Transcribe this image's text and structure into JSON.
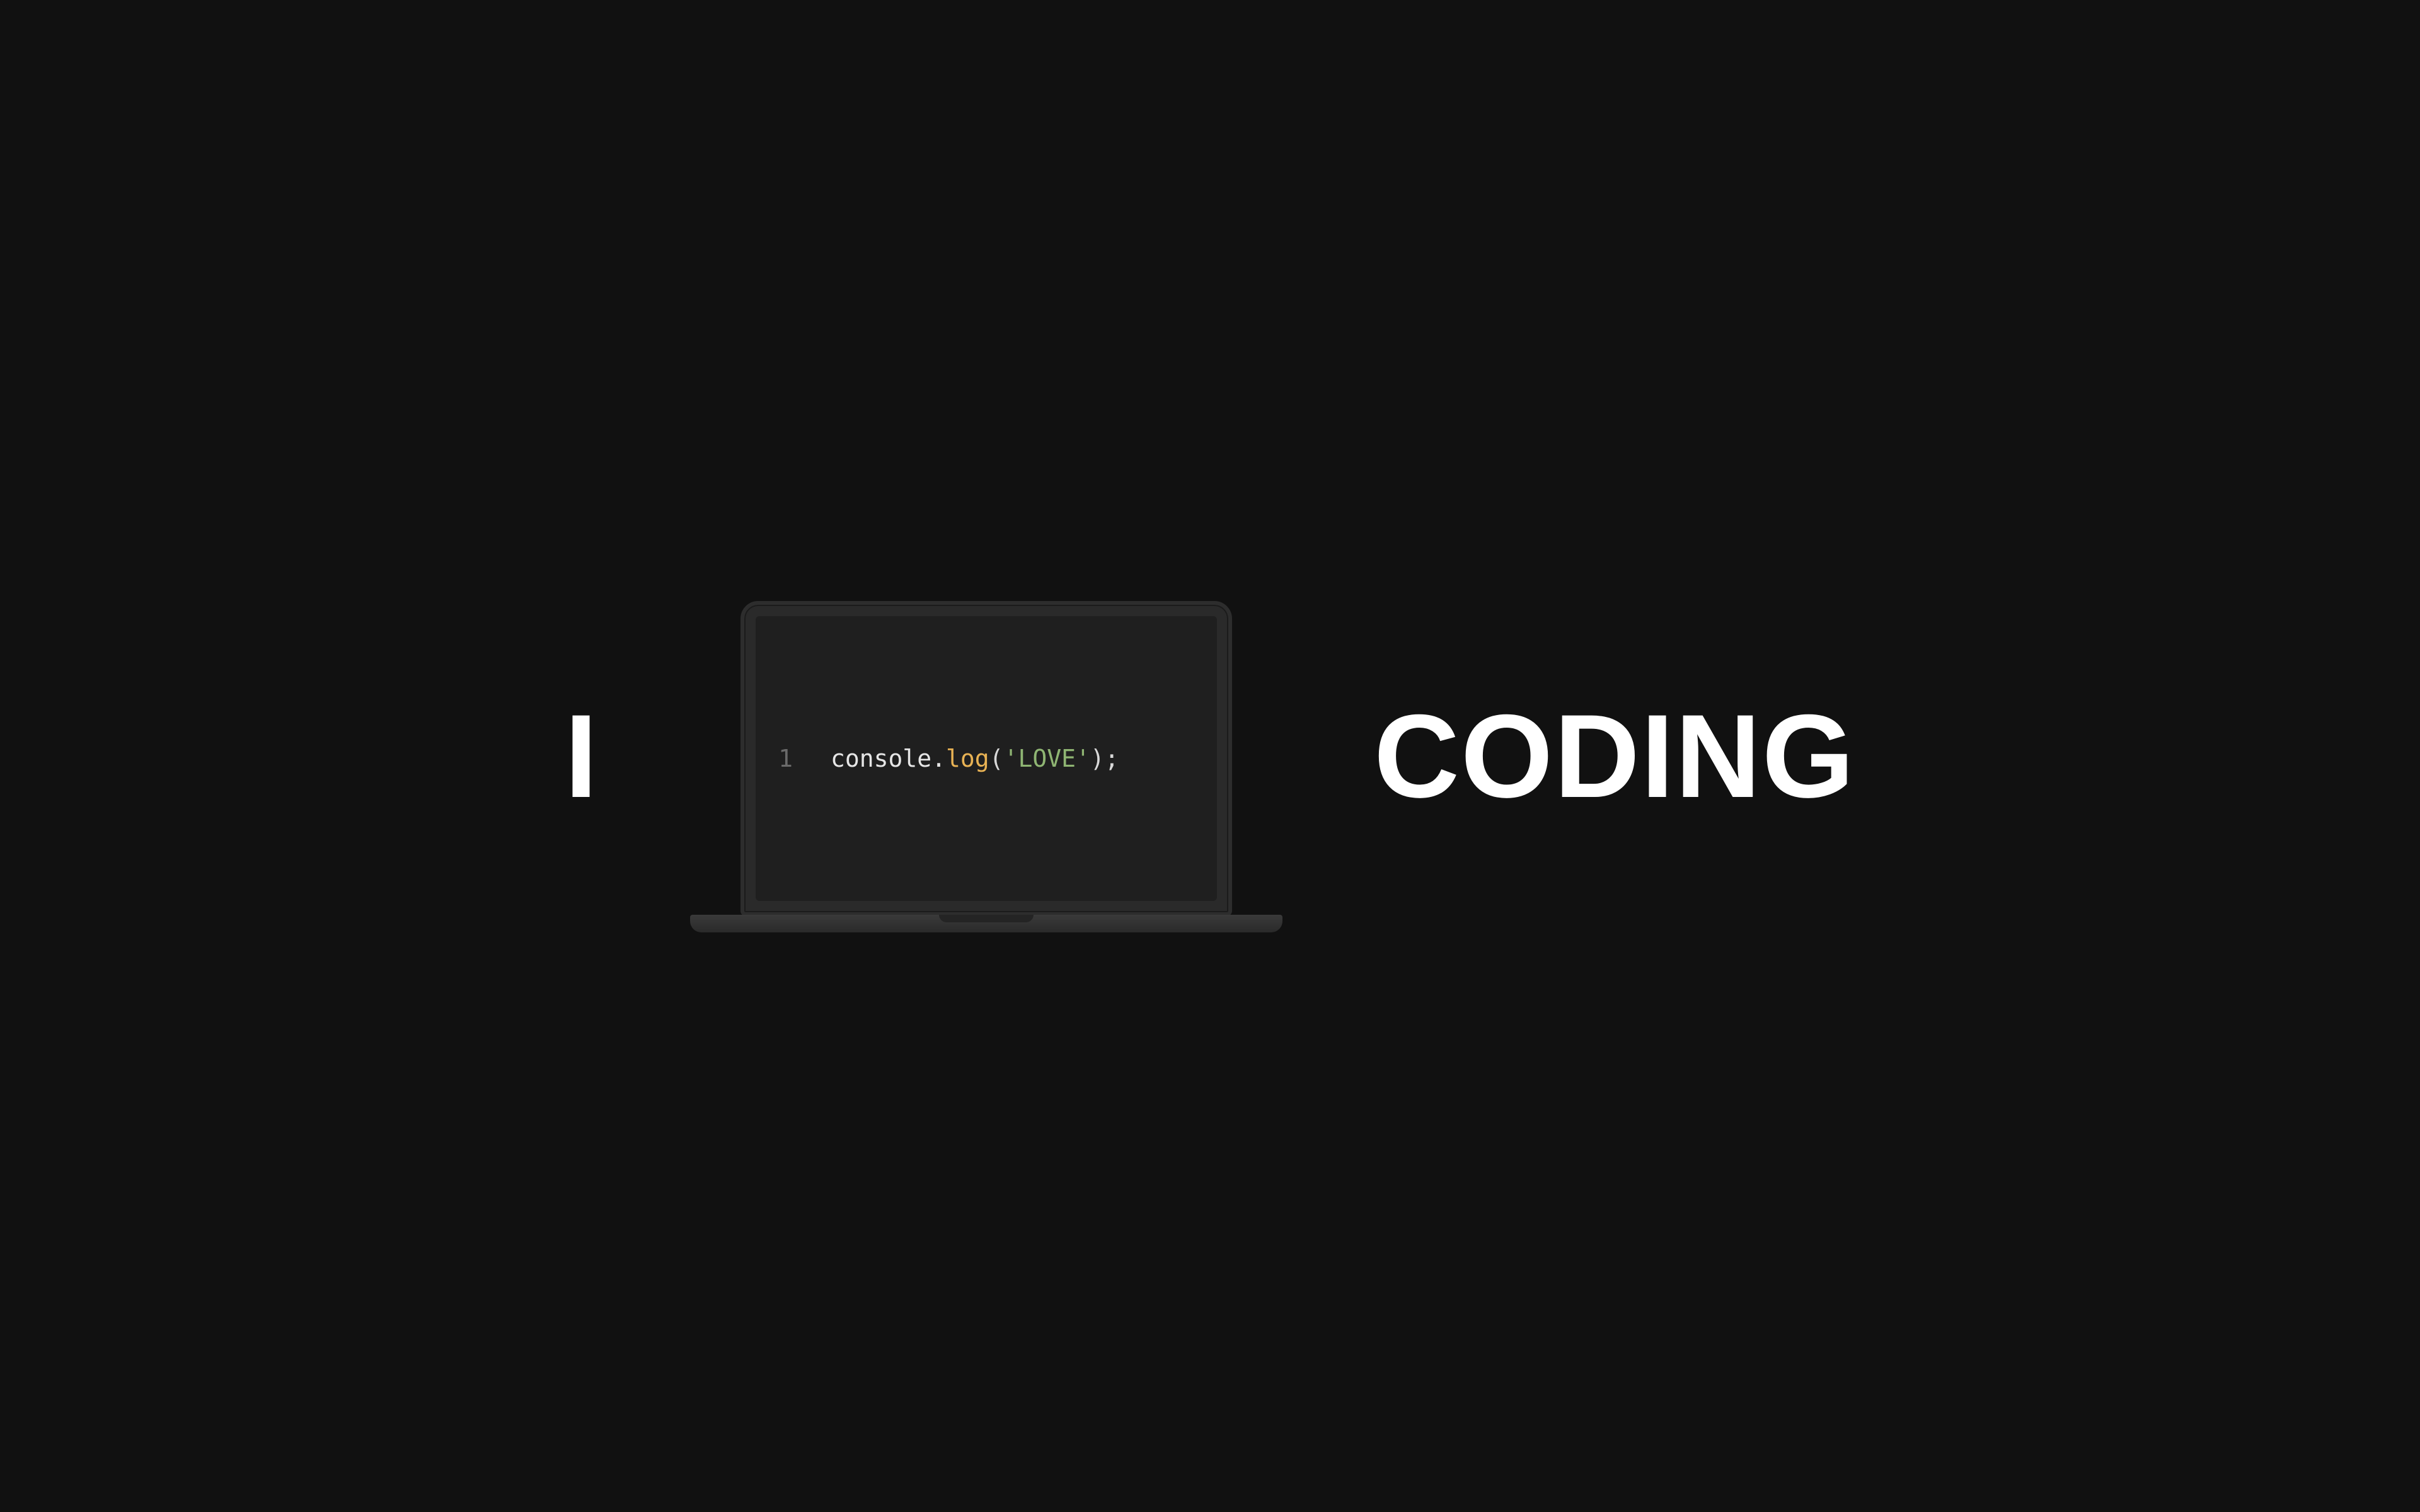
{
  "left_word": "I",
  "right_word": "CODING",
  "code": {
    "lineno": "1",
    "object": "console",
    "dot": ".",
    "method": "log",
    "open_paren": "(",
    "string": "'LOVE'",
    "close_paren": ")",
    "semi": ";"
  }
}
